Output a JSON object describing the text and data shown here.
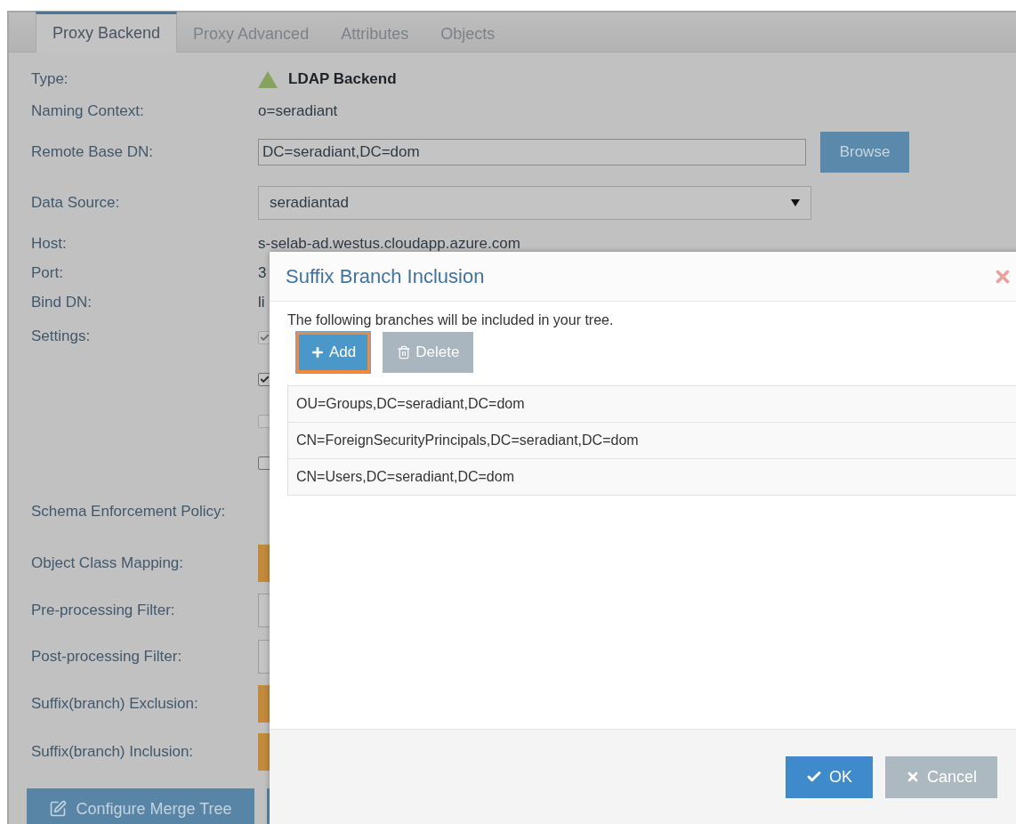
{
  "tabs": [
    {
      "label": "Proxy Backend",
      "selected": true
    },
    {
      "label": "Proxy Advanced",
      "selected": false
    },
    {
      "label": "Attributes",
      "selected": false
    },
    {
      "label": "Objects",
      "selected": false
    }
  ],
  "fields": [
    {
      "kind": "type",
      "label": "Type:",
      "value": "LDAP Backend"
    },
    {
      "kind": "text",
      "label": "Naming Context:",
      "value": "o=seradiant"
    },
    {
      "kind": "input",
      "label": "Remote Base DN:",
      "value": "DC=seradiant,DC=dom",
      "button": "Browse"
    },
    {
      "kind": "select",
      "label": "Data Source:",
      "value": "seradiantad"
    },
    {
      "kind": "text",
      "label": "Host:",
      "value": "s-selab-ad.westus.cloudapp.azure.com"
    },
    {
      "kind": "text",
      "label": "Port:",
      "value": "3"
    },
    {
      "kind": "text",
      "label": "Bind DN:",
      "value": "li"
    },
    {
      "kind": "checks",
      "label": "Settings:",
      "checkboxes": [
        {
          "checked": true,
          "disabled": true
        },
        {
          "checked": true,
          "disabled": false
        },
        {
          "checked": false,
          "disabled": true
        },
        {
          "checked": false,
          "disabled": false
        }
      ]
    },
    {
      "kind": "blank",
      "label": "Schema Enforcement Policy:"
    },
    {
      "kind": "action",
      "label": "Object Class Mapping:"
    },
    {
      "kind": "filter",
      "label": "Pre-processing Filter:"
    },
    {
      "kind": "filter",
      "label": "Post-processing Filter:"
    },
    {
      "kind": "action",
      "label": "Suffix(branch) Exclusion:"
    },
    {
      "kind": "action",
      "label": "Suffix(branch) Inclusion:"
    }
  ],
  "configure_button": "Configure Merge Tree",
  "dialog": {
    "title": "Suffix Branch Inclusion",
    "description": "The following branches will be included in your tree.",
    "toolbar": [
      {
        "kind": "add",
        "label": "Add",
        "focused": true,
        "disabled": false
      },
      {
        "kind": "delete",
        "label": "Delete",
        "focused": false,
        "disabled": true
      }
    ],
    "branches": [
      "OU=Groups,DC=seradiant,DC=dom",
      "CN=ForeignSecurityPrincipals,DC=seradiant,DC=dom",
      "CN=Users,DC=seradiant,DC=dom"
    ],
    "buttons": [
      {
        "kind": "ok",
        "label": "OK"
      },
      {
        "kind": "cancel",
        "label": "Cancel"
      }
    ]
  }
}
